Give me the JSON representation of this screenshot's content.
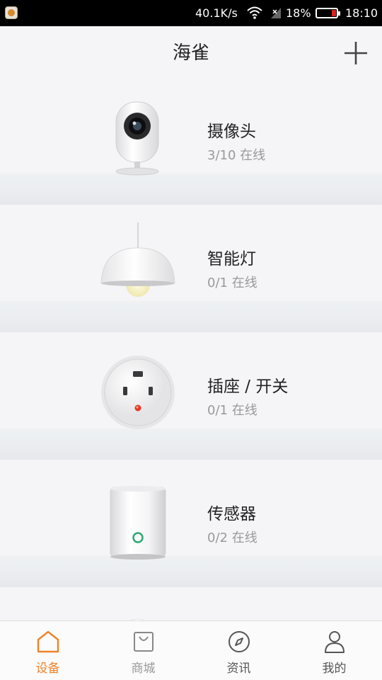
{
  "status_bar": {
    "speed": "40.1K/s",
    "battery": "18%",
    "time": "18:10"
  },
  "header": {
    "title": "海雀"
  },
  "devices": [
    {
      "name": "摄像头",
      "status": "3/10 在线"
    },
    {
      "name": "智能灯",
      "status": "0/1 在线"
    },
    {
      "name": "插座 / 开关",
      "status": "0/1 在线"
    },
    {
      "name": "传感器",
      "status": "0/2 在线"
    }
  ],
  "bottom_nav": [
    {
      "label": "设备",
      "icon": "home-icon",
      "active": true
    },
    {
      "label": "商城",
      "icon": "shopping-bag-icon",
      "active": false
    },
    {
      "label": "资讯",
      "icon": "compass-icon",
      "active": false
    },
    {
      "label": "我的",
      "icon": "user-icon",
      "active": false
    }
  ],
  "colors": {
    "accent": "#f0822a",
    "background": "#f5f4f7",
    "status_text": "#999999"
  }
}
